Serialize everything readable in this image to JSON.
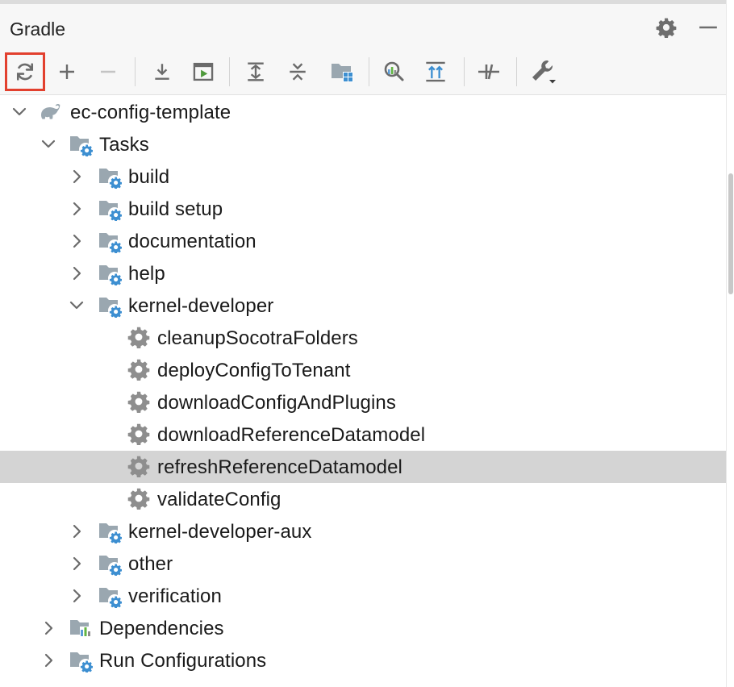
{
  "panel": {
    "title": "Gradle"
  },
  "header_icons": [
    "gear-icon",
    "minimize-icon"
  ],
  "toolbar": {
    "buttons": [
      {
        "name": "reload-all-gradle-projects",
        "icon": "sync-icon",
        "active": true
      },
      {
        "name": "add-gradle-project",
        "icon": "plus-icon"
      },
      {
        "name": "remove-gradle-project",
        "icon": "minus-icon"
      },
      {
        "name": "download-sources",
        "icon": "download-icon"
      },
      {
        "name": "execute-gradle-task",
        "icon": "run-window-icon"
      },
      {
        "name": "expand-all",
        "icon": "expand-all-icon"
      },
      {
        "name": "collapse-all",
        "icon": "collapse-all-icon"
      },
      {
        "name": "group-modules",
        "icon": "folder-grid-icon"
      },
      {
        "name": "analyze-dependencies",
        "icon": "analyze-icon"
      },
      {
        "name": "show-dependencies",
        "icon": "dependencies-icon"
      },
      {
        "name": "toggle-offline-mode",
        "icon": "offline-icon"
      },
      {
        "name": "build-tool-settings",
        "icon": "wrench-icon"
      }
    ]
  },
  "colors": {
    "selection": "#d4d4d4",
    "active_outline": "#e2402e",
    "gear_blue": "#3d8fd1",
    "folder_gray": "#9aa7b0"
  },
  "tree": {
    "root": "ec-config-template",
    "tasks": "Tasks",
    "groups": {
      "build": "build",
      "build_setup": "build setup",
      "documentation": "documentation",
      "help": "help",
      "kernel_developer": "kernel-developer",
      "kernel_developer_aux": "kernel-developer-aux",
      "other": "other",
      "verification": "verification"
    },
    "kernel_tasks": [
      "cleanupSocotraFolders",
      "deployConfigToTenant",
      "downloadConfigAndPlugins",
      "downloadReferenceDatamodel",
      "refreshReferenceDatamodel",
      "validateConfig"
    ],
    "selected_task": "refreshReferenceDatamodel",
    "dependencies": "Dependencies",
    "run_configurations": "Run Configurations"
  }
}
